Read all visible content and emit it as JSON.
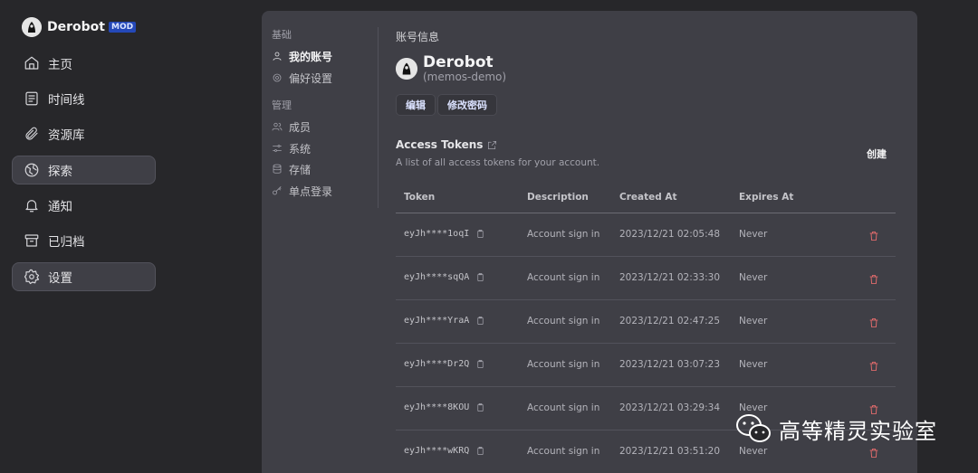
{
  "brand": {
    "name": "Derobot",
    "badge": "MOD"
  },
  "nav": [
    {
      "id": "home",
      "label": "主页",
      "icon": "home-icon",
      "active": false
    },
    {
      "id": "timeline",
      "label": "时间线",
      "icon": "timeline-icon",
      "active": false
    },
    {
      "id": "resources",
      "label": "资源库",
      "icon": "paperclip-icon",
      "active": false
    },
    {
      "id": "explore",
      "label": "探索",
      "icon": "globe-icon",
      "active": true
    },
    {
      "id": "notifications",
      "label": "通知",
      "icon": "bell-icon",
      "active": false
    },
    {
      "id": "archived",
      "label": "已归档",
      "icon": "archive-icon",
      "active": false
    },
    {
      "id": "settings",
      "label": "设置",
      "icon": "gear-icon",
      "active": true
    }
  ],
  "settings_nav": {
    "basic_heading": "基础",
    "basic_items": [
      {
        "label": "我的账号",
        "icon": "user-icon",
        "active": true
      },
      {
        "label": "偏好设置",
        "icon": "cog-icon",
        "active": false
      }
    ],
    "admin_heading": "管理",
    "admin_items": [
      {
        "label": "成员",
        "icon": "users-icon"
      },
      {
        "label": "系统",
        "icon": "sliders-icon"
      },
      {
        "label": "存储",
        "icon": "database-icon"
      },
      {
        "label": "单点登录",
        "icon": "key-icon"
      }
    ]
  },
  "account": {
    "section_title": "账号信息",
    "display_name": "Derobot",
    "username": "(memos-demo)",
    "edit_label": "编辑",
    "change_password_label": "修改密码"
  },
  "tokens": {
    "title": "Access Tokens",
    "description": "A list of all access tokens for your account.",
    "create_label": "创建",
    "columns": [
      "Token",
      "Description",
      "Created At",
      "Expires At"
    ],
    "rows": [
      {
        "token": "eyJh****1oqI",
        "description": "Account sign in",
        "created": "2023/12/21 02:05:48",
        "expires": "Never"
      },
      {
        "token": "eyJh****sqQA",
        "description": "Account sign in",
        "created": "2023/12/21 02:33:30",
        "expires": "Never"
      },
      {
        "token": "eyJh****YraA",
        "description": "Account sign in",
        "created": "2023/12/21 02:47:25",
        "expires": "Never"
      },
      {
        "token": "eyJh****Dr2Q",
        "description": "Account sign in",
        "created": "2023/12/21 03:07:23",
        "expires": "Never"
      },
      {
        "token": "eyJh****8KOU",
        "description": "Account sign in",
        "created": "2023/12/21 03:29:34",
        "expires": "Never"
      },
      {
        "token": "eyJh****wKRQ",
        "description": "Account sign in",
        "created": "2023/12/21 03:51:20",
        "expires": "Never"
      }
    ]
  },
  "watermark": {
    "text": "高等精灵实验室"
  },
  "colors": {
    "accent": "#2448b8",
    "danger": "#f87171",
    "panel": "#3f3f46",
    "background": "#27272a"
  }
}
